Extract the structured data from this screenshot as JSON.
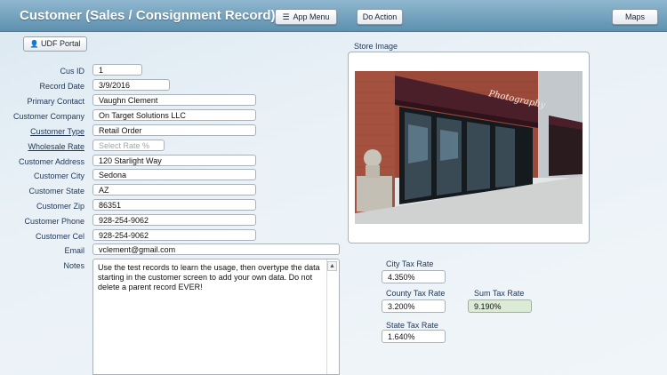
{
  "header": {
    "title": "Customer (Sales / Consignment Record)",
    "app_menu_label": "App Menu",
    "do_action_label": "Do Action",
    "maps_label": "Maps"
  },
  "udf_portal_label": "UDF Portal",
  "form": {
    "cus_id": {
      "label": "Cus ID",
      "value": "1"
    },
    "record_date": {
      "label": "Record Date",
      "value": "3/9/2016"
    },
    "primary_contact": {
      "label": "Primary Contact",
      "value": "Vaughn Clement"
    },
    "customer_company": {
      "label": "Customer Company",
      "value": "On Target Solutions LLC"
    },
    "customer_type": {
      "label": "Customer Type",
      "value": "Retail Order"
    },
    "wholesale_rate": {
      "label": "Wholesale Rate",
      "placeholder": "Select Rate %"
    },
    "customer_address": {
      "label": "Customer Address",
      "value": "120 Starlight Way"
    },
    "customer_city": {
      "label": "Customer City",
      "value": "Sedona"
    },
    "customer_state": {
      "label": "Customer State",
      "value": "AZ"
    },
    "customer_zip": {
      "label": "Customer Zip",
      "value": "86351"
    },
    "customer_phone": {
      "label": "Customer Phone",
      "value": "928-254-9062"
    },
    "customer_cel": {
      "label": "Customer Cel",
      "value": "928-254-9062"
    },
    "email": {
      "label": "Email",
      "value": "vclement@gmail.com"
    },
    "notes": {
      "label": "Notes",
      "value": "Use the test records to learn the usage, then overtype the data starting in the customer screen to add your own data. Do not delete a parent record EVER!"
    }
  },
  "store_image": {
    "label": "Store Image",
    "sign_text": "Photography"
  },
  "tax": {
    "city": {
      "label": "City Tax Rate",
      "value": "4.350%"
    },
    "county": {
      "label": "County Tax Rate",
      "value": "3.200%"
    },
    "sum": {
      "label": "Sum Tax Rate",
      "value": "9.190%"
    },
    "state": {
      "label": "State Tax Rate",
      "value": "1.640%"
    }
  },
  "colors": {
    "header_top": "#8fb7cf",
    "header_bottom": "#5e90ae",
    "sum_field_bg": "#dcebd6"
  }
}
